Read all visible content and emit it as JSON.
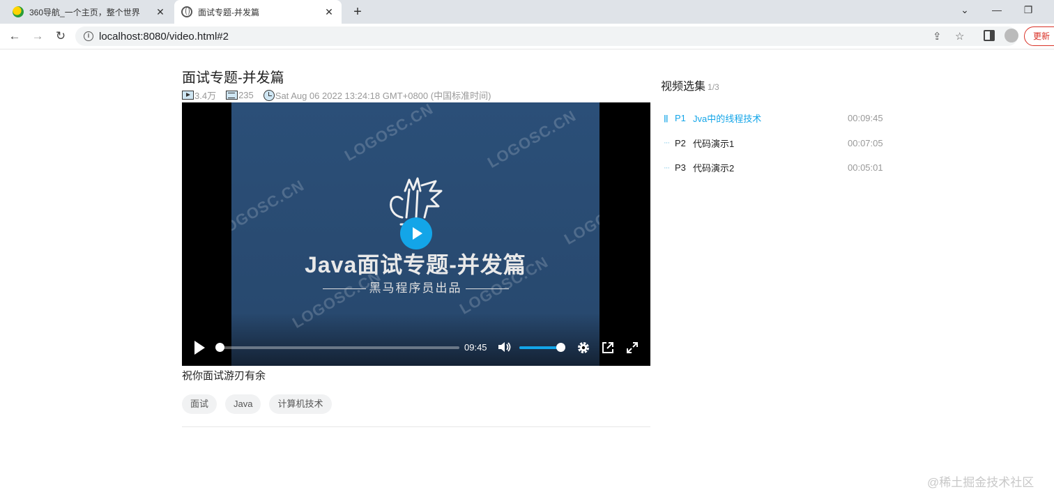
{
  "browser": {
    "tabs": [
      {
        "title": "360导航_一个主页，整个世界",
        "active": false,
        "icon": "360-logo-icon"
      },
      {
        "title": "面试专题-并发篇",
        "active": true,
        "icon": "globe-icon"
      }
    ],
    "url": "localhost:8080/video.html#2",
    "update_label": "更新"
  },
  "video": {
    "title": "面试专题-并发篇",
    "views": "3.4万",
    "danmaku": "235",
    "date": "Sat Aug 06 2022 13:24:18 GMT+0800 (中国标准时间)",
    "poster": {
      "title": "Java面试专题-并发篇",
      "subtitle": "黑马程序员出品",
      "watermark": "LOGOSC.CN"
    },
    "controls": {
      "duration": "09:45",
      "progress": 0.0,
      "volume": 0.95
    },
    "description": "祝你面试游刃有余",
    "tags": [
      "面试",
      "Java",
      "计算机技术"
    ]
  },
  "playlist": {
    "heading": "视频选集",
    "count": "1/3",
    "items": [
      {
        "part": "P1",
        "name": "Jva中的线程技术",
        "duration": "00:09:45",
        "active": true,
        "mark": "|||"
      },
      {
        "part": "P2",
        "name": "代码演示1",
        "duration": "00:07:05",
        "active": false,
        "mark": "···"
      },
      {
        "part": "P3",
        "name": "代码演示2",
        "duration": "00:05:01",
        "active": false,
        "mark": "···"
      }
    ]
  },
  "site_watermark": "@稀土掘金技术社区",
  "colors": {
    "accent": "#13a5e8",
    "poster_bg": "#2b4f78",
    "update_red": "#d93025"
  }
}
